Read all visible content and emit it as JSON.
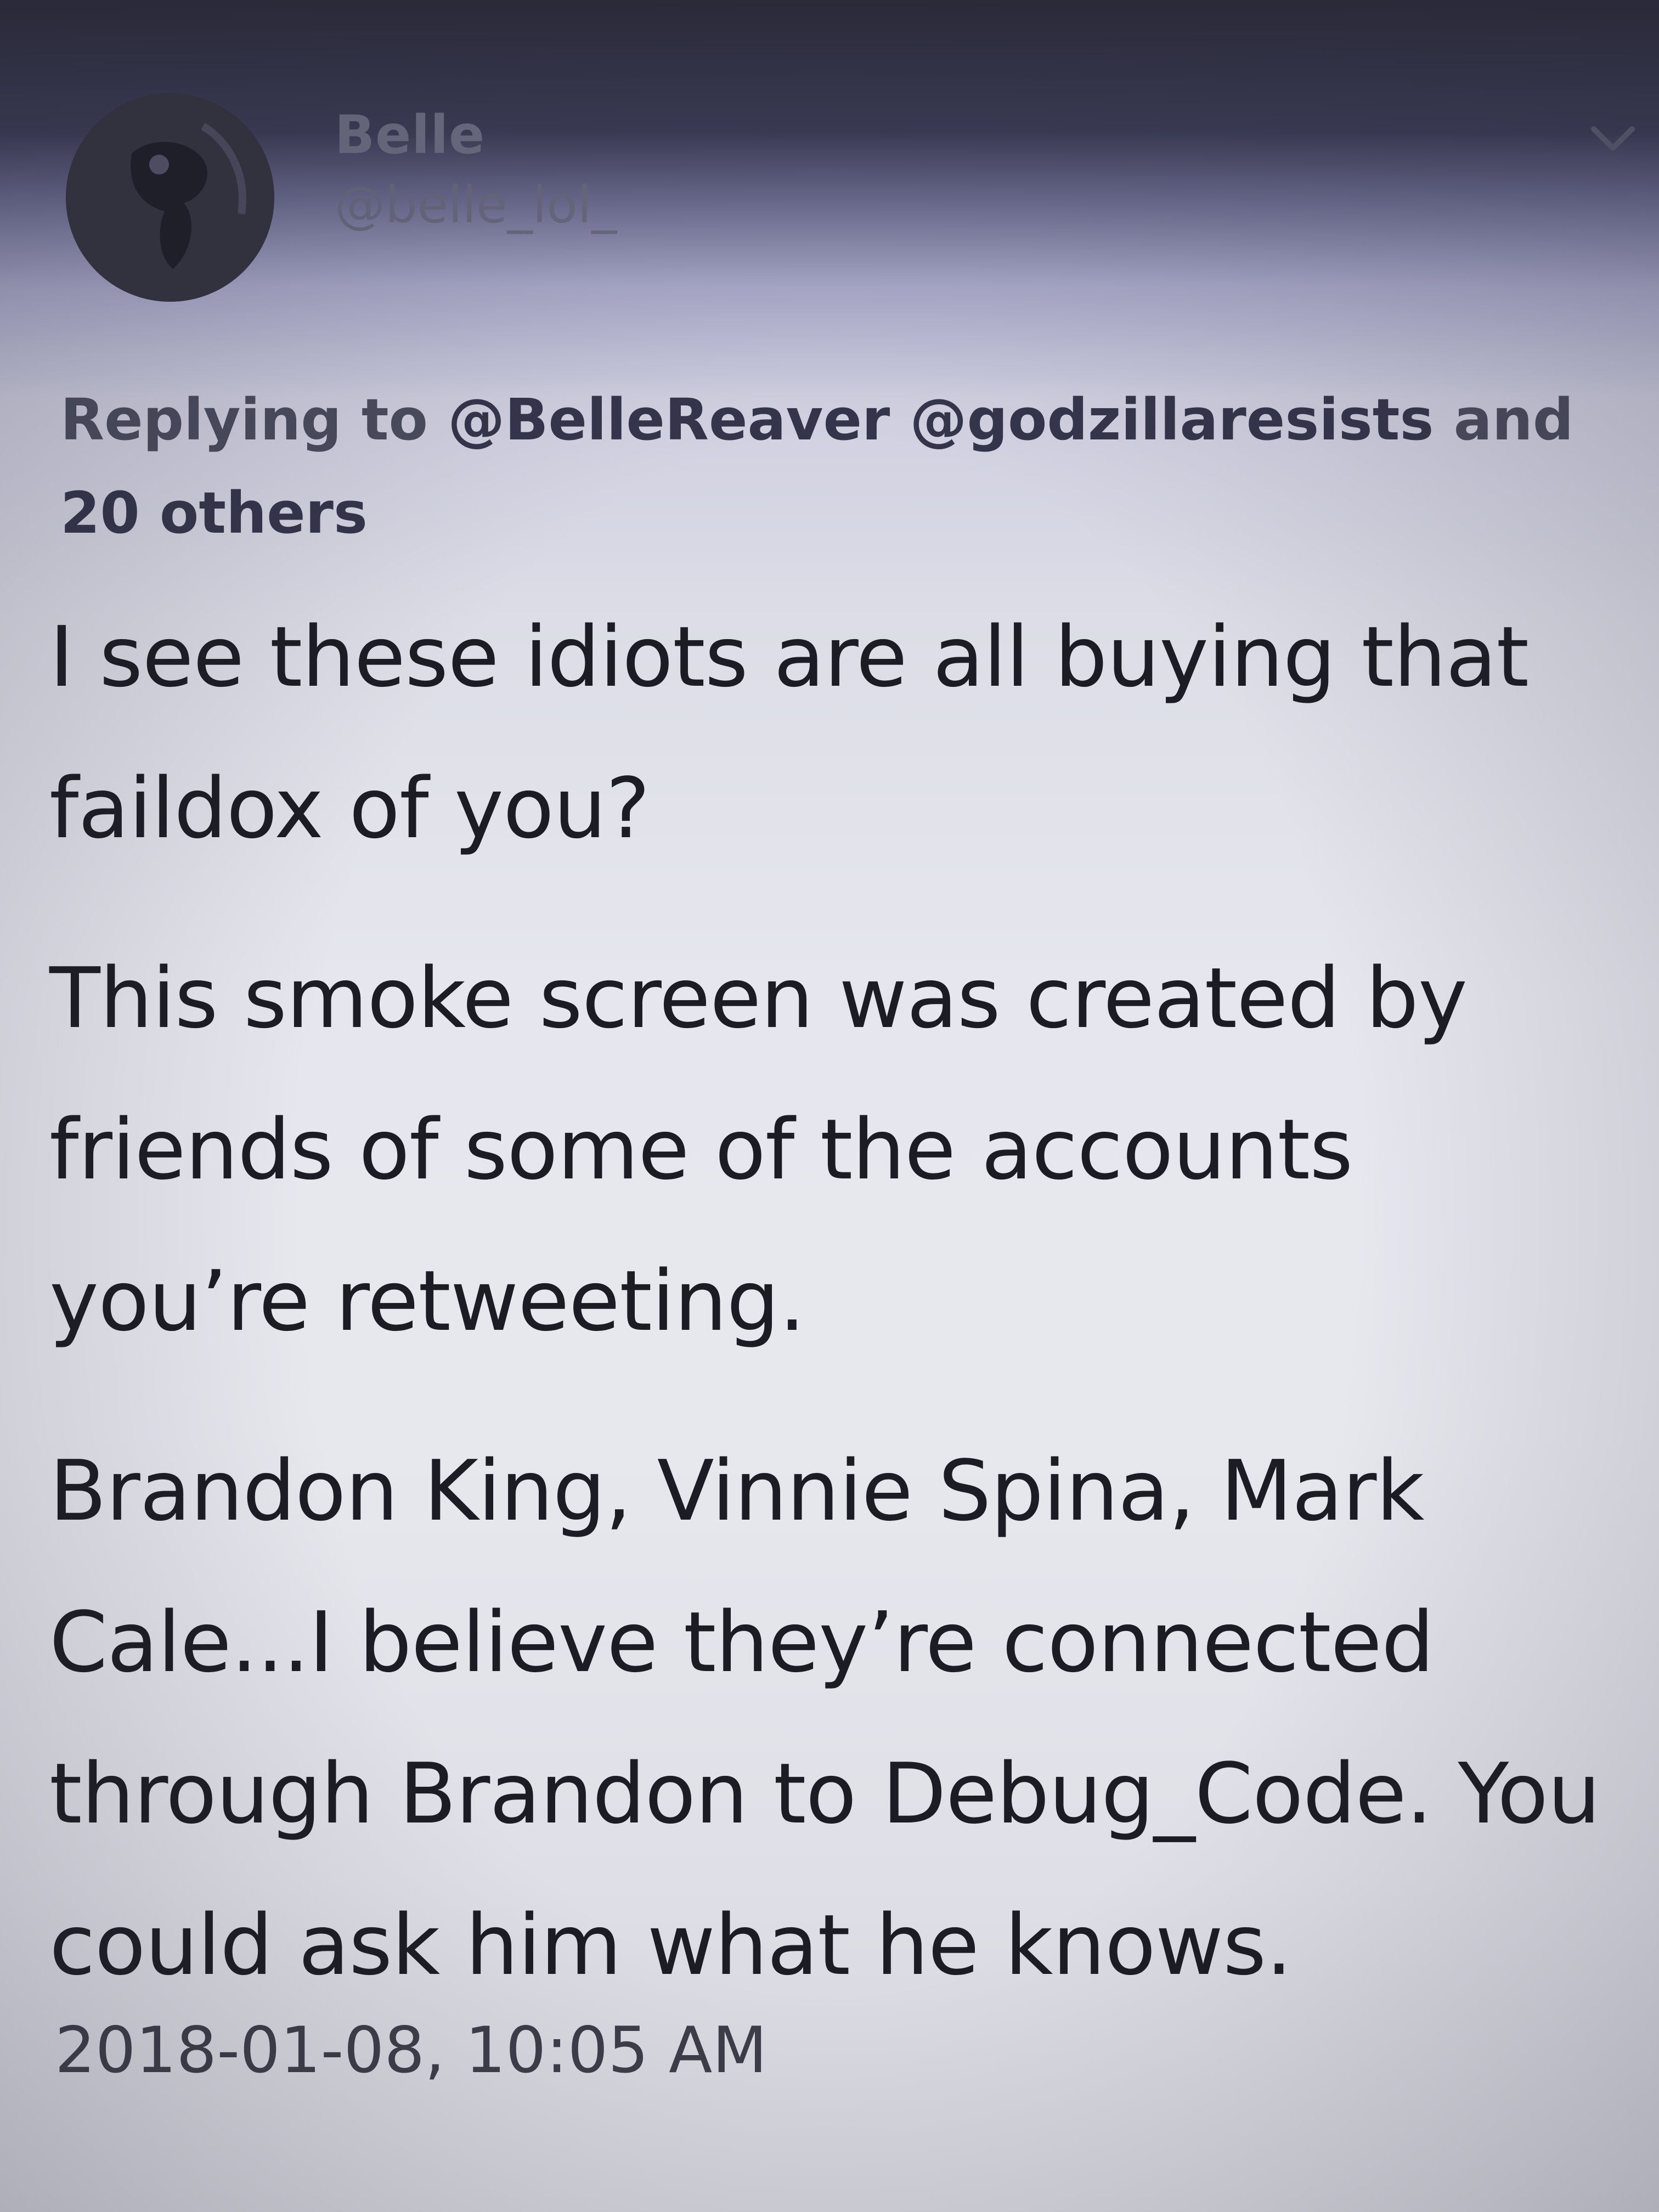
{
  "tweet": {
    "author": {
      "display_name": "Belle",
      "handle": "@belle_lol_"
    },
    "reply_to": {
      "prefix": "Replying to",
      "handles": [
        "@BelleReaver",
        "@godzillaresists"
      ],
      "and_label": "and",
      "others": "20 others"
    },
    "paragraphs": [
      "I see these idiots are all buying that faildox of you?",
      "This smoke screen was created by friends of some of the accounts you’re retweeting.",
      "Brandon King, Vinnie Spina, Mark Cale...I believe they’re connected through Brandon to Debug_Code. You could ask him what he knows."
    ],
    "timestamp": "2018-01-08, 10:05 AM"
  },
  "icons": {
    "avatar": "avatar-image",
    "menu": "chevron-down-icon"
  }
}
